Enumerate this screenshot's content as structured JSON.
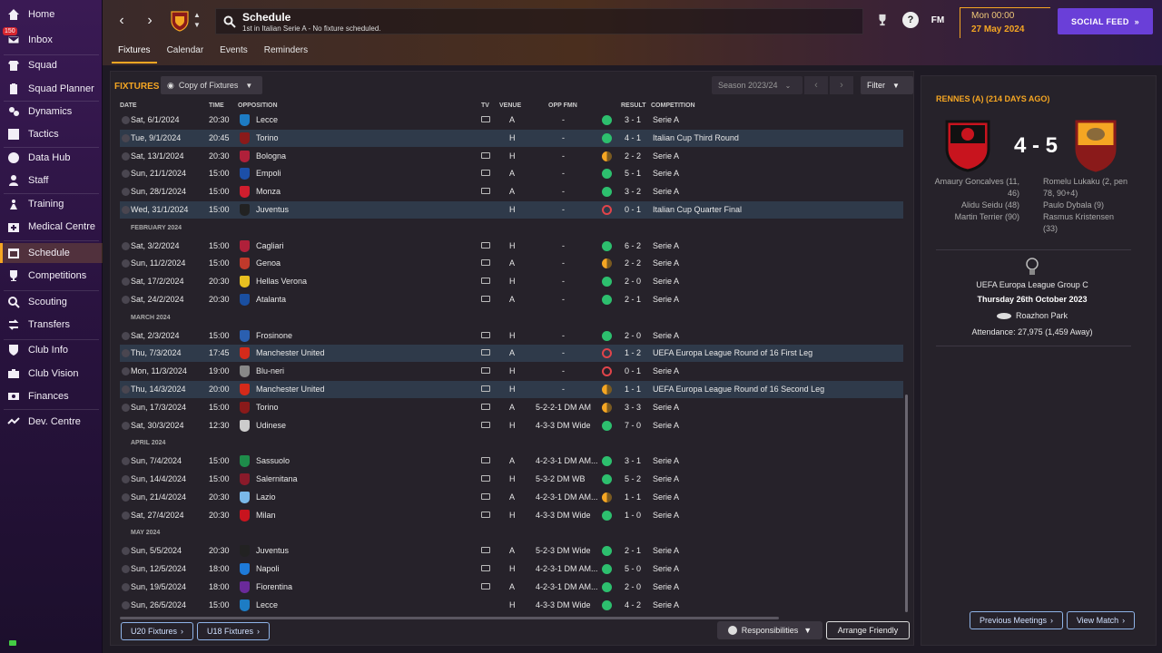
{
  "sidebar": {
    "inbox_badge": "150",
    "items": [
      {
        "label": "Home",
        "icon": "home-icon"
      },
      {
        "label": "Inbox",
        "icon": "inbox-icon"
      },
      {
        "label": "Squad",
        "icon": "squad-icon"
      },
      {
        "label": "Squad Planner",
        "icon": "clipboard-icon"
      },
      {
        "label": "Dynamics",
        "icon": "dynamics-icon"
      },
      {
        "label": "Tactics",
        "icon": "tactics-icon"
      },
      {
        "label": "Data Hub",
        "icon": "data-hub-icon"
      },
      {
        "label": "Staff",
        "icon": "staff-icon"
      },
      {
        "label": "Training",
        "icon": "training-icon"
      },
      {
        "label": "Medical Centre",
        "icon": "medical-icon"
      },
      {
        "label": "Schedule",
        "icon": "calendar-icon"
      },
      {
        "label": "Competitions",
        "icon": "trophy-icon"
      },
      {
        "label": "Scouting",
        "icon": "scouting-icon"
      },
      {
        "label": "Transfers",
        "icon": "transfers-icon"
      },
      {
        "label": "Club Info",
        "icon": "shield-icon"
      },
      {
        "label": "Club Vision",
        "icon": "vision-icon"
      },
      {
        "label": "Finances",
        "icon": "finances-icon"
      },
      {
        "label": "Dev. Centre",
        "icon": "dev-centre-icon"
      }
    ]
  },
  "header": {
    "title": "Schedule",
    "subtitle": "1st in Italian Serie A - No fixture scheduled.",
    "fm_label": "FM",
    "help_label": "?",
    "time": "Mon 00:00",
    "date": "27 May 2024",
    "social_feed": "SOCIAL FEED",
    "tabs": [
      "Fixtures",
      "Calendar",
      "Events",
      "Reminders"
    ]
  },
  "toolbar": {
    "title": "FIXTURES",
    "copy_of_fixtures": "Copy of Fixtures",
    "season": "Season 2023/24",
    "filter": "Filter"
  },
  "columns": {
    "date": "DATE",
    "time": "TIME",
    "opposition": "OPPOSITION",
    "tv": "TV",
    "venue": "VENUE",
    "opp_fmn": "OPP FMN",
    "result": "RESULT",
    "competition": "COMPETITION"
  },
  "colors": {
    "win": "#2dbf6e",
    "loss": "#e0444a",
    "draw": "#f5a623",
    "accent": "#f5a623",
    "social": "#6a3fd8"
  },
  "fixtures": [
    {
      "date": "Sat, 6/1/2024",
      "time": "20:30",
      "opp": "Lecce",
      "tv": true,
      "venue": "A",
      "fmn": "-",
      "outcome": "w",
      "result": "3 - 1",
      "comp": "Serie A",
      "hl": false,
      "crest": "#1d7cc4"
    },
    {
      "date": "Tue, 9/1/2024",
      "time": "20:45",
      "opp": "Torino",
      "tv": false,
      "venue": "H",
      "fmn": "-",
      "outcome": "w",
      "result": "4 - 1",
      "comp": "Italian Cup Third Round",
      "hl": true,
      "crest": "#8a1a1a"
    },
    {
      "date": "Sat, 13/1/2024",
      "time": "20:30",
      "opp": "Bologna",
      "tv": true,
      "venue": "H",
      "fmn": "-",
      "outcome": "d",
      "result": "2 - 2",
      "comp": "Serie A",
      "hl": false,
      "crest": "#b0203a"
    },
    {
      "date": "Sun, 21/1/2024",
      "time": "15:00",
      "opp": "Empoli",
      "tv": true,
      "venue": "A",
      "fmn": "-",
      "outcome": "w",
      "result": "5 - 1",
      "comp": "Serie A",
      "hl": false,
      "crest": "#1c4fa8"
    },
    {
      "date": "Sun, 28/1/2024",
      "time": "15:00",
      "opp": "Monza",
      "tv": true,
      "venue": "A",
      "fmn": "-",
      "outcome": "w",
      "result": "3 - 2",
      "comp": "Serie A",
      "hl": false,
      "crest": "#d01e2e"
    },
    {
      "date": "Wed, 31/1/2024",
      "time": "15:00",
      "opp": "Juventus",
      "tv": false,
      "venue": "H",
      "fmn": "-",
      "outcome": "l",
      "result": "0 - 1",
      "comp": "Italian Cup Quarter Final",
      "hl": true,
      "crest": "#222222"
    },
    {
      "month": "FEBRUARY 2024"
    },
    {
      "date": "Sat, 3/2/2024",
      "time": "15:00",
      "opp": "Cagliari",
      "tv": true,
      "venue": "H",
      "fmn": "-",
      "outcome": "w",
      "result": "6 - 2",
      "comp": "Serie A",
      "hl": false,
      "crest": "#b0203a"
    },
    {
      "date": "Sun, 11/2/2024",
      "time": "15:00",
      "opp": "Genoa",
      "tv": true,
      "venue": "A",
      "fmn": "-",
      "outcome": "d",
      "result": "2 - 2",
      "comp": "Serie A",
      "hl": false,
      "crest": "#c0392b"
    },
    {
      "date": "Sat, 17/2/2024",
      "time": "20:30",
      "opp": "Hellas Verona",
      "tv": true,
      "venue": "H",
      "fmn": "-",
      "outcome": "w",
      "result": "2 - 0",
      "comp": "Serie A",
      "hl": false,
      "crest": "#e8c020"
    },
    {
      "date": "Sat, 24/2/2024",
      "time": "20:30",
      "opp": "Atalanta",
      "tv": true,
      "venue": "A",
      "fmn": "-",
      "outcome": "w",
      "result": "2 - 1",
      "comp": "Serie A",
      "hl": false,
      "crest": "#1a4fa0"
    },
    {
      "month": "MARCH 2024"
    },
    {
      "date": "Sat, 2/3/2024",
      "time": "15:00",
      "opp": "Frosinone",
      "tv": true,
      "venue": "H",
      "fmn": "-",
      "outcome": "w",
      "result": "2 - 0",
      "comp": "Serie A",
      "hl": false,
      "crest": "#2a5fb0"
    },
    {
      "date": "Thu, 7/3/2024",
      "time": "17:45",
      "opp": "Manchester United",
      "tv": true,
      "venue": "A",
      "fmn": "-",
      "outcome": "l",
      "result": "1 - 2",
      "comp": "UEFA Europa League Round of 16  First Leg",
      "hl": true,
      "crest": "#d42a1a"
    },
    {
      "date": "Mon, 11/3/2024",
      "time": "19:00",
      "opp": "Blu-neri",
      "tv": true,
      "venue": "H",
      "fmn": "-",
      "outcome": "l",
      "result": "0 - 1",
      "comp": "Serie A",
      "hl": false,
      "crest": "#888888"
    },
    {
      "date": "Thu, 14/3/2024",
      "time": "20:00",
      "opp": "Manchester United",
      "tv": true,
      "venue": "H",
      "fmn": "-",
      "outcome": "d",
      "result": "1 - 1",
      "comp": "UEFA Europa League Round of 16  Second Leg",
      "hl": true,
      "crest": "#d42a1a"
    },
    {
      "date": "Sun, 17/3/2024",
      "time": "15:00",
      "opp": "Torino",
      "tv": true,
      "venue": "A",
      "fmn": "5-2-2-1 DM AM",
      "outcome": "d",
      "result": "3 - 3",
      "comp": "Serie A",
      "hl": false,
      "crest": "#8a1a1a"
    },
    {
      "date": "Sat, 30/3/2024",
      "time": "12:30",
      "opp": "Udinese",
      "tv": true,
      "venue": "H",
      "fmn": "4-3-3 DM Wide",
      "outcome": "w",
      "result": "7 - 0",
      "comp": "Serie A",
      "hl": false,
      "crest": "#cccccc"
    },
    {
      "month": "APRIL 2024"
    },
    {
      "date": "Sun, 7/4/2024",
      "time": "15:00",
      "opp": "Sassuolo",
      "tv": true,
      "venue": "A",
      "fmn": "4-2-3-1 DM AM...",
      "outcome": "w",
      "result": "3 - 1",
      "comp": "Serie A",
      "hl": false,
      "crest": "#1e8c4a"
    },
    {
      "date": "Sun, 14/4/2024",
      "time": "15:00",
      "opp": "Salernitana",
      "tv": true,
      "venue": "H",
      "fmn": "5-3-2 DM WB",
      "outcome": "w",
      "result": "5 - 2",
      "comp": "Serie A",
      "hl": false,
      "crest": "#8a1a2a"
    },
    {
      "date": "Sun, 21/4/2024",
      "time": "20:30",
      "opp": "Lazio",
      "tv": true,
      "venue": "A",
      "fmn": "4-2-3-1 DM AM...",
      "outcome": "d",
      "result": "1 - 1",
      "comp": "Serie A",
      "hl": false,
      "crest": "#7ab8e8"
    },
    {
      "date": "Sat, 27/4/2024",
      "time": "20:30",
      "opp": "Milan",
      "tv": true,
      "venue": "H",
      "fmn": "4-3-3 DM Wide",
      "outcome": "w",
      "result": "1 - 0",
      "comp": "Serie A",
      "hl": false,
      "crest": "#c8141e"
    },
    {
      "month": "MAY 2024"
    },
    {
      "date": "Sun, 5/5/2024",
      "time": "20:30",
      "opp": "Juventus",
      "tv": true,
      "venue": "A",
      "fmn": "5-2-3 DM Wide",
      "outcome": "w",
      "result": "2 - 1",
      "comp": "Serie A",
      "hl": false,
      "crest": "#222222"
    },
    {
      "date": "Sun, 12/5/2024",
      "time": "18:00",
      "opp": "Napoli",
      "tv": true,
      "venue": "H",
      "fmn": "4-2-3-1 DM AM...",
      "outcome": "w",
      "result": "5 - 0",
      "comp": "Serie A",
      "hl": false,
      "crest": "#1e7ad8"
    },
    {
      "date": "Sun, 19/5/2024",
      "time": "18:00",
      "opp": "Fiorentina",
      "tv": true,
      "venue": "A",
      "fmn": "4-2-3-1 DM AM...",
      "outcome": "w",
      "result": "2 - 0",
      "comp": "Serie A",
      "hl": false,
      "crest": "#6a2a9a"
    },
    {
      "date": "Sun, 26/5/2024",
      "time": "15:00",
      "opp": "Lecce",
      "tv": false,
      "venue": "H",
      "fmn": "4-3-3 DM Wide",
      "outcome": "w",
      "result": "4 - 2",
      "comp": "Serie A",
      "hl": false,
      "crest": "#1d7cc4"
    }
  ],
  "footer": {
    "u20": "U20 Fixtures",
    "u18": "U18 Fixtures",
    "responsibilities": "Responsibilities",
    "arrange_friendly": "Arrange Friendly"
  },
  "last_meeting": {
    "title": "RENNES (A) (214 DAYS AGO)",
    "home_score": "4",
    "away_score": "5",
    "home_scorers": [
      "Amaury Goncalves (11,",
      "46)",
      "Alidu Seidu (48)",
      "Martin Terrier (90)"
    ],
    "away_scorers": [
      "Romelu Lukaku (2, pen",
      "78, 90+4)",
      "Paulo Dybala (9)",
      "Rasmus Kristensen",
      "(33)"
    ],
    "competition": "UEFA Europa League Group C",
    "date": "Thursday 26th October 2023",
    "stadium": "Roazhon Park",
    "attendance": "Attendance: 27,975 (1,459 Away)",
    "prev_meetings": "Previous Meetings",
    "view_match": "View Match"
  }
}
